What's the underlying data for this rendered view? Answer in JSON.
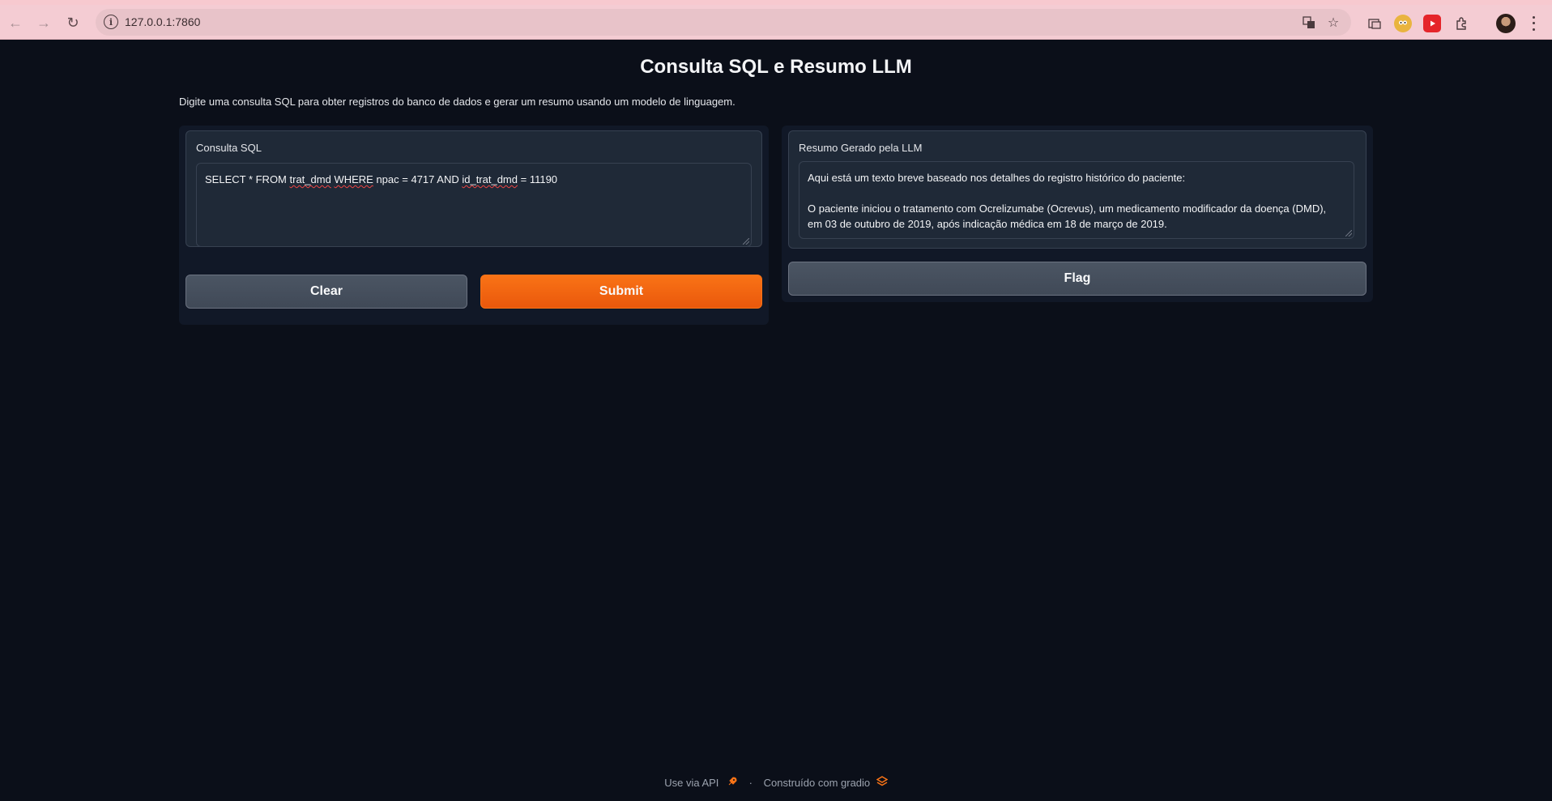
{
  "browser": {
    "url": "127.0.0.1:7860"
  },
  "app": {
    "title": "Consulta SQL e Resumo LLM",
    "description": "Digite uma consulta SQL para obter registros do banco de dados e gerar um resumo usando um modelo de linguagem.",
    "sql_input": {
      "label": "Consulta SQL",
      "value_parts": [
        "SELECT * FROM ",
        "trat_dmd",
        " ",
        "WHERE",
        " npac = 4717 AND ",
        "id_trat_dmd",
        " = 11190"
      ]
    },
    "summary_output": {
      "label": "Resumo Gerado pela LLM",
      "line1": "Aqui está um texto breve baseado nos detalhes do registro histórico do paciente:",
      "line2": "O paciente iniciou o tratamento com Ocrelizumabe (Ocrevus), um medicamento modificador da doença (DMD),",
      "line3": "em 03 de outubro de 2019, após indicação médica em 18 de março de 2019."
    },
    "buttons": {
      "clear": "Clear",
      "submit": "Submit",
      "flag": "Flag"
    },
    "footer": {
      "api": "Use via API",
      "separator": "·",
      "built_with": "Construído com gradio"
    }
  }
}
